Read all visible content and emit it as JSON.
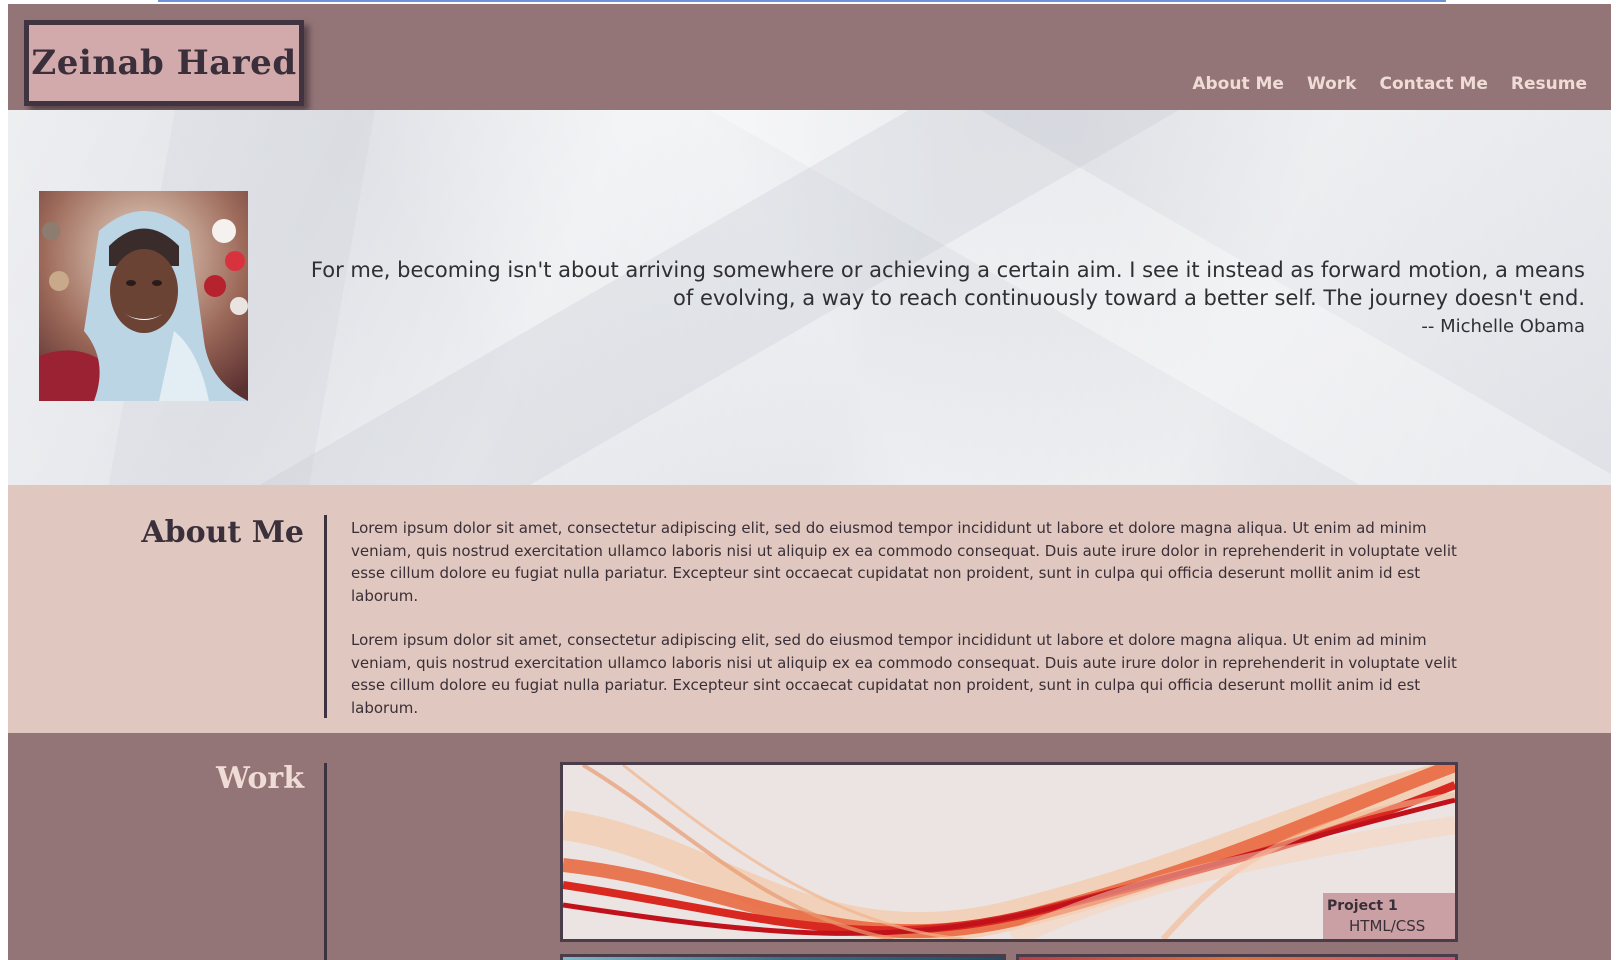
{
  "header": {
    "logo_text": "Zeinab Hared",
    "nav": [
      {
        "label": "About Me"
      },
      {
        "label": "Work"
      },
      {
        "label": "Contact Me"
      },
      {
        "label": "Resume"
      }
    ]
  },
  "hero": {
    "quote": "For me, becoming isn't about arriving somewhere or achieving a certain aim. I see it instead as forward motion, a means of evolving, a way to reach continuously toward a better self. The journey doesn't end.",
    "author": "-- Michelle Obama"
  },
  "about": {
    "title": "About Me",
    "paragraphs": [
      "Lorem ipsum dolor sit amet, consectetur adipiscing elit, sed do eiusmod tempor incididunt ut labore et dolore magna aliqua. Ut enim ad minim veniam, quis nostrud exercitation ullamco laboris nisi ut aliquip ex ea commodo consequat. Duis aute irure dolor in reprehenderit in voluptate velit esse cillum dolore eu fugiat nulla pariatur. Excepteur sint occaecat cupidatat non proident, sunt in culpa qui officia deserunt mollit anim id est laborum.",
      "Lorem ipsum dolor sit amet, consectetur adipiscing elit, sed do eiusmod tempor incididunt ut labore et dolore magna aliqua. Ut enim ad minim veniam, quis nostrud exercitation ullamco laboris nisi ut aliquip ex ea commodo consequat. Duis aute irure dolor in reprehenderit in voluptate velit esse cillum dolore eu fugiat nulla pariatur. Excepteur sint occaecat cupidatat non proident, sunt in culpa qui officia deserunt mollit anim id est laborum."
    ]
  },
  "work": {
    "title": "Work",
    "projects": [
      {
        "name": "Project 1",
        "tech": "HTML/CSS"
      }
    ]
  },
  "colors": {
    "header_bg": "#947577",
    "logo_bg": "#d3aaac",
    "about_bg": "#e0c7bf",
    "nav_text": "#f0dcd6",
    "dark_text": "#3a2f3a"
  }
}
